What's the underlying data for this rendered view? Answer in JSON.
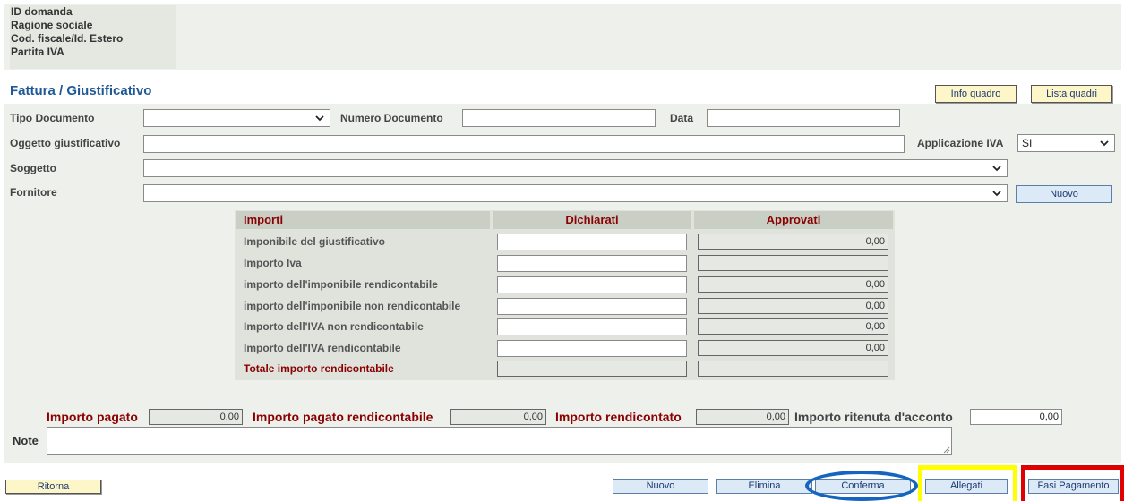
{
  "header": {
    "labels": [
      "ID domanda",
      "Ragione sociale",
      "Cod. fiscale/Id. Estero",
      "Partita IVA"
    ]
  },
  "section": {
    "title": "Fattura / Giustificativo",
    "info_quadro": "Info quadro",
    "lista_quadri": "Lista quadri"
  },
  "form": {
    "tipo_documento_label": "Tipo Documento",
    "tipo_documento_value": "",
    "numero_documento_label": "Numero Documento",
    "numero_documento_value": "",
    "data_label": "Data",
    "data_value": "",
    "oggetto_label": "Oggetto giustificativo",
    "oggetto_value": "",
    "applicazione_iva_label": "Applicazione IVA",
    "applicazione_iva_value": "SI",
    "soggetto_label": "Soggetto",
    "soggetto_value": "",
    "fornitore_label": "Fornitore",
    "fornitore_value": "",
    "nuovo_fornitore": "Nuovo"
  },
  "importi": {
    "headers": [
      "Importi",
      "Dichiarati",
      "Approvati"
    ],
    "rows": [
      {
        "label": "Imponibile del giustificativo",
        "dichiarati": "",
        "approvati": "0,00"
      },
      {
        "label": "Importo Iva",
        "dichiarati": "",
        "approvati": ""
      },
      {
        "label": "importo dell'imponibile rendicontabile",
        "dichiarati": "",
        "approvati": "0,00"
      },
      {
        "label": "importo dell'imponibile non rendicontabile",
        "dichiarati": "",
        "approvati": "0,00"
      },
      {
        "label": "Importo dell'IVA non rendicontabile",
        "dichiarati": "",
        "approvati": "0,00"
      },
      {
        "label": "Importo dell'IVA rendicontabile",
        "dichiarati": "",
        "approvati": "0,00"
      }
    ],
    "totale_label": "Totale importo rendicontabile",
    "totale_dichiarati": "",
    "totale_approvati": ""
  },
  "summary": {
    "importo_pagato_label": "Importo pagato",
    "importo_pagato_value": "0,00",
    "importo_pagato_rend_label": "Importo pagato rendicontabile",
    "importo_pagato_rend_value": "0,00",
    "importo_rendicontato_label": "Importo rendicontato",
    "importo_rendicontato_value": "0,00",
    "ritenuta_label": "Importo ritenuta d'acconto",
    "ritenuta_value": "0,00",
    "note_label": "Note",
    "note_value": ""
  },
  "footer": {
    "ritorna": "Ritorna",
    "nuovo": "Nuovo",
    "elimina": "Elimina",
    "conferma": "Conferma",
    "allegati": "Allegati",
    "fasi_pagamento": "Fasi Pagamento"
  },
  "colors": {
    "title_blue": "#1f5a96",
    "label_red": "#8b0000",
    "highlight_blue": "#1565c0",
    "highlight_yellow": "#ffff00",
    "highlight_red": "#e00000"
  }
}
